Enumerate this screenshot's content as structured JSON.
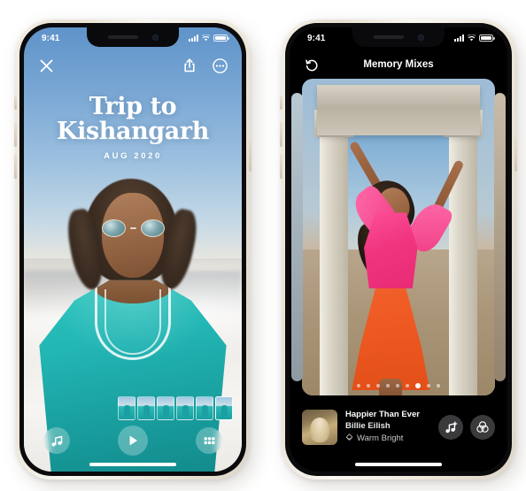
{
  "page": {
    "title": "Apple Photos Memories — iPhone marketing screenshot",
    "background": "#ffffff"
  },
  "colors": {
    "accent_teal": "#22b5b3",
    "accent_pink": "#f0357f",
    "accent_orange": "#ee5a22",
    "sky_blue": "#78a6d4",
    "dark_ui": "#000000",
    "button_grey": "#3a3a3c"
  },
  "phones": [
    {
      "id": "memory-cover",
      "status_bar": {
        "time": "9:41",
        "signal_icon": "cellular-signal-icon",
        "wifi_icon": "wifi-icon",
        "battery_icon": "battery-icon"
      },
      "top_bar": {
        "close_icon": "close-icon",
        "share_icon": "share-icon",
        "more_icon": "more-options-icon"
      },
      "memory": {
        "title_line1": "Trip to",
        "title_line2": "Kishangarh",
        "date": "AUG 2020"
      },
      "filmstrip": {
        "name": "memory-filmstrip",
        "thumbnail_count": 6,
        "selected_index": 5
      },
      "controls": {
        "music_icon": "music-note-icon",
        "play_icon": "play-icon",
        "grid_icon": "grid-icon"
      },
      "home_indicator": "home-indicator"
    },
    {
      "id": "memory-mixes",
      "status_bar": {
        "time": "9:41",
        "signal_icon": "cellular-signal-icon",
        "wifi_icon": "wifi-icon",
        "battery_icon": "battery-icon"
      },
      "nav": {
        "back_icon": "undo-arrow-icon",
        "title": "Memory Mixes"
      },
      "pagination": {
        "dot_count": 9,
        "active_index": 6
      },
      "now_playing": {
        "album_art": "album-artwork",
        "track_title": "Happier Than Ever",
        "artist": "Billie Eilish",
        "filter_icon": "filter-style-icon",
        "filter_name": "Warm Bright",
        "music_add_icon": "music-note-add-icon",
        "color_filter_icon": "color-filter-icon"
      },
      "home_indicator": "home-indicator"
    }
  ]
}
